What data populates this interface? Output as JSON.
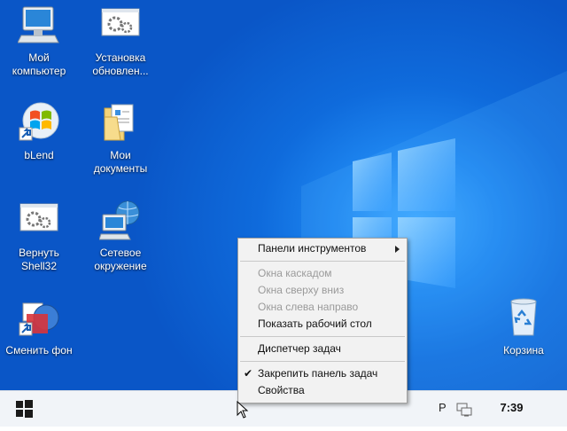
{
  "desktop": {
    "icons": [
      {
        "id": "my-computer",
        "label": "Мой\nкомпьютер"
      },
      {
        "id": "updates",
        "label": "Установка\nобновлен..."
      },
      {
        "id": "blend",
        "label": "bLend"
      },
      {
        "id": "my-documents",
        "label": "Мои\nдокументы"
      },
      {
        "id": "shell32",
        "label": "Вернуть\nShell32"
      },
      {
        "id": "network",
        "label": "Сетевое\nокружение"
      },
      {
        "id": "wallpaper",
        "label": "Сменить фон"
      },
      {
        "id": "recycle-bin",
        "label": "Корзина"
      }
    ]
  },
  "context_menu": {
    "items": [
      {
        "label": "Панели инструментов",
        "enabled": true,
        "submenu": true
      },
      {
        "label": "Окна каскадом",
        "enabled": false
      },
      {
        "label": "Окна сверху вниз",
        "enabled": false
      },
      {
        "label": "Окна слева направо",
        "enabled": false
      },
      {
        "label": "Показать рабочий стол",
        "enabled": true
      },
      {
        "label": "Диспетчер задач",
        "enabled": true
      },
      {
        "label": "Закрепить панель задач",
        "enabled": true,
        "checked": true
      },
      {
        "label": "Свойства",
        "enabled": true
      }
    ],
    "check_glyph": "✔"
  },
  "taskbar": {
    "start_icon": "windows-logo-icon",
    "language": "Р",
    "network_icon": "network-icon",
    "clock": "7:39"
  },
  "colors": {
    "desktop_blue": "#0f6bdc",
    "taskbar": "#f1f4f8",
    "menu_bg": "#f2f2f2"
  }
}
